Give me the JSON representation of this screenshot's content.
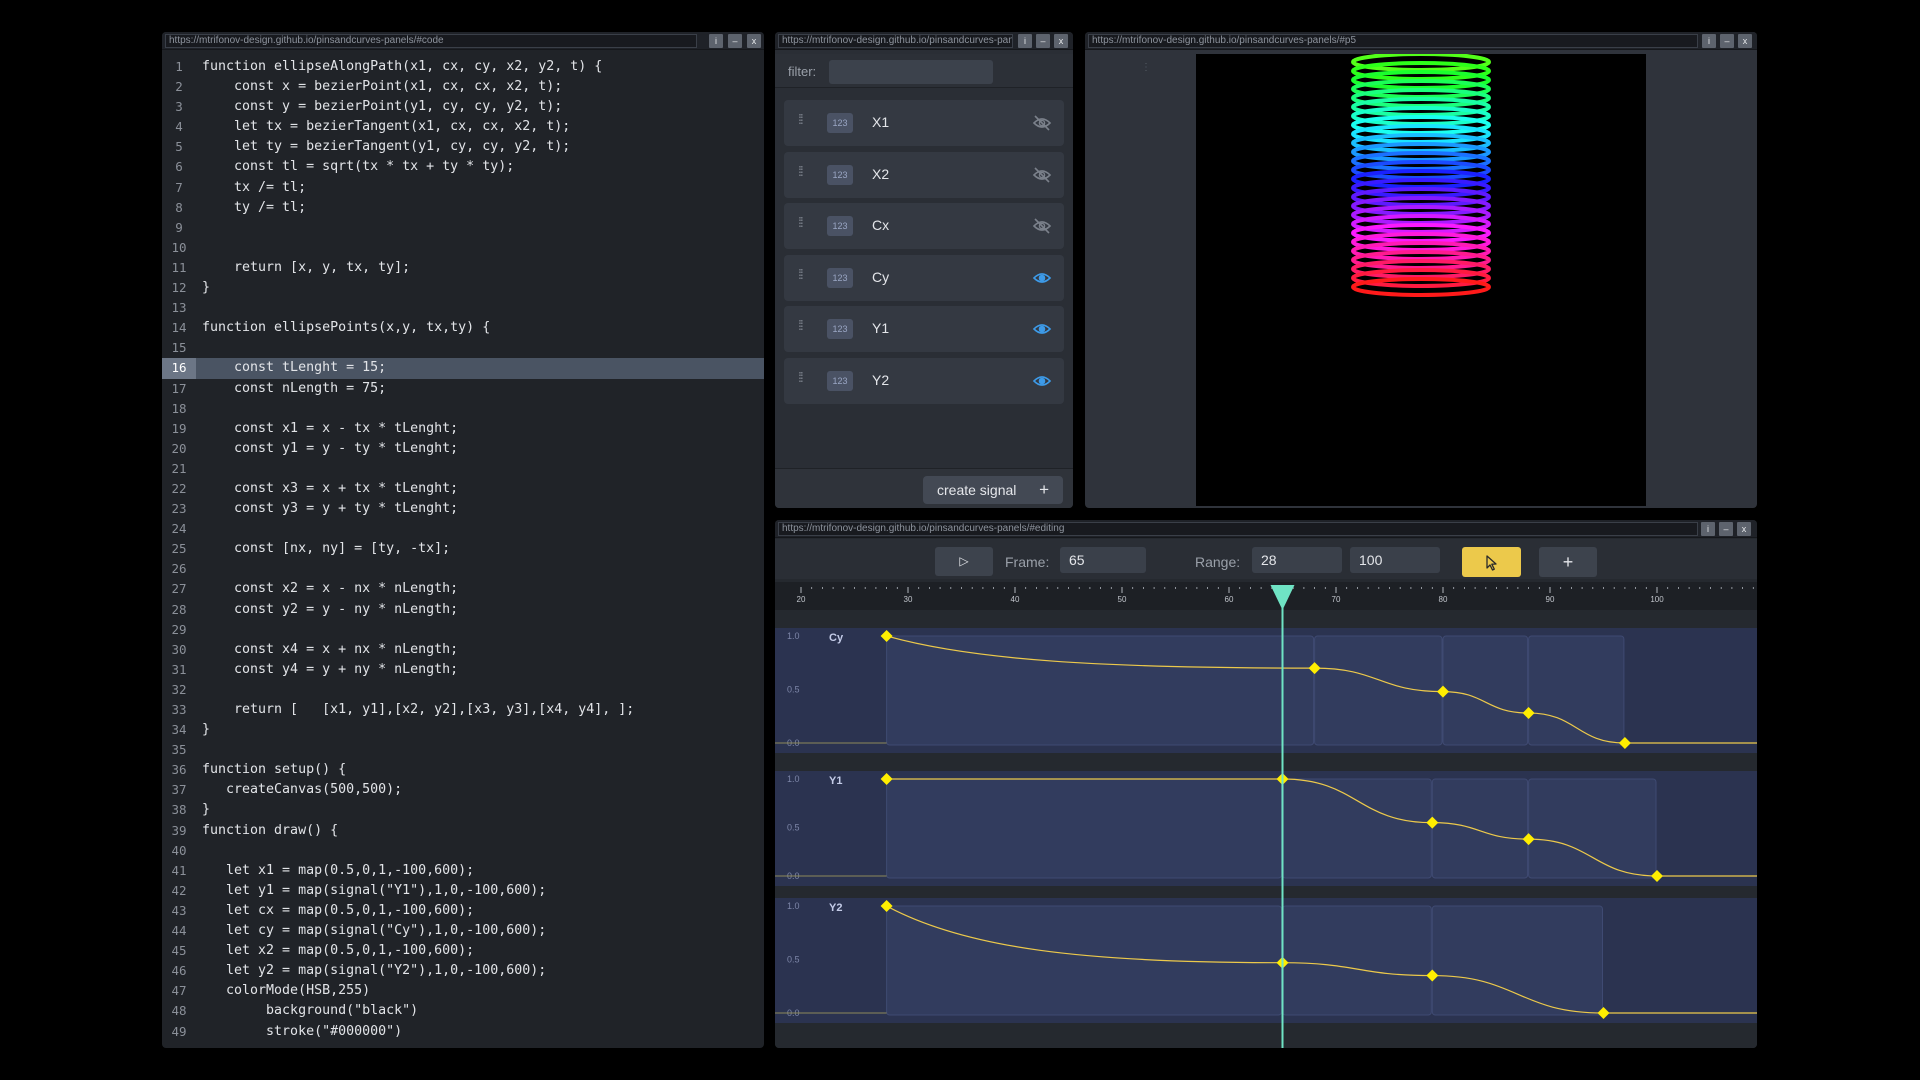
{
  "code_window": {
    "url": "https://mtrifonov-design.github.io/pinsandcurves-panels/#code",
    "buttons": [
      "i",
      "–",
      "x"
    ],
    "active_line": 16,
    "lines": [
      "function ellipseAlongPath(x1, cx, cy, x2, y2, t) {",
      "    const x = bezierPoint(x1, cx, cx, x2, t);",
      "    const y = bezierPoint(y1, cy, cy, y2, t);",
      "    let tx = bezierTangent(x1, cx, cx, x2, t);",
      "    let ty = bezierTangent(y1, cy, cy, y2, t);",
      "    const tl = sqrt(tx * tx + ty * ty);",
      "    tx /= tl;",
      "    ty /= tl;",
      "",
      "",
      "    return [x, y, tx, ty];",
      "}",
      "",
      "function ellipsePoints(x,y, tx,ty) {",
      "",
      "    const tLenght = 15;",
      "    const nLength = 75;",
      "",
      "    const x1 = x - tx * tLenght;",
      "    const y1 = y - ty * tLenght;",
      "",
      "    const x3 = x + tx * tLenght;",
      "    const y3 = y + ty * tLenght;",
      "",
      "    const [nx, ny] = [ty, -tx];",
      "",
      "    const x2 = x - nx * nLength;",
      "    const y2 = y - ny * nLength;",
      "",
      "    const x4 = x + nx * nLength;",
      "    const y4 = y + ny * nLength;",
      "",
      "    return [   [x1, y1],[x2, y2],[x3, y3],[x4, y4], ];",
      "}",
      "",
      "function setup() {",
      "   createCanvas(500,500);",
      "}",
      "function draw() {",
      "",
      "   let x1 = map(0.5,0,1,-100,600);",
      "   let y1 = map(signal(\"Y1\"),1,0,-100,600);",
      "   let cx = map(0.5,0,1,-100,600);",
      "   let cy = map(signal(\"Cy\"),1,0,-100,600);",
      "   let x2 = map(0.5,0,1,-100,600);",
      "   let y2 = map(signal(\"Y2\"),1,0,-100,600);",
      "   colorMode(HSB,255)",
      "        background(\"black\")",
      "        stroke(\"#000000\")"
    ]
  },
  "signals_window": {
    "url": "https://mtrifonov-design.github.io/pinsandcurves-panels/#signals",
    "buttons": [
      "i",
      "–",
      "x"
    ],
    "filter_label": "filter:",
    "filter_value": "",
    "type_badge": "123",
    "items": [
      {
        "name": "X1",
        "visible": false
      },
      {
        "name": "X2",
        "visible": false
      },
      {
        "name": "Cx",
        "visible": false
      },
      {
        "name": "Cy",
        "visible": true
      },
      {
        "name": "Y1",
        "visible": true
      },
      {
        "name": "Y2",
        "visible": true
      }
    ],
    "create_label": "create signal",
    "create_icon": "+"
  },
  "p5_window": {
    "url": "https://mtrifonov-design.github.io/pinsandcurves-panels/#p5",
    "buttons": [
      "i",
      "–",
      "x"
    ],
    "grip": "⋮"
  },
  "timeline_window": {
    "url": "https://mtrifonov-design.github.io/pinsandcurves-panels/#editing",
    "buttons": [
      "i",
      "–",
      "x"
    ],
    "play_icon": "▷",
    "frame_label": "Frame:",
    "frame_value": "65",
    "range_label": "Range:",
    "range_start": "28",
    "range_end": "100",
    "add_icon": "+",
    "ruler_labels": [
      20,
      30,
      40,
      50,
      60,
      70,
      80,
      90,
      100
    ],
    "playhead_frame": 65,
    "accent_color": "#ecc94b",
    "playhead_color": "#6fe3c4",
    "y_ticks": [
      "1.0",
      "0.5",
      "0.0"
    ],
    "tracks": [
      {
        "name": "Cy",
        "pins": [
          [
            28,
            1.0
          ],
          [
            68,
            0.7
          ],
          [
            80,
            0.48
          ],
          [
            88,
            0.28
          ],
          [
            97,
            0.0
          ]
        ]
      },
      {
        "name": "Y1",
        "pins": [
          [
            28,
            1.0
          ],
          [
            65,
            1.0
          ],
          [
            79,
            0.55
          ],
          [
            88,
            0.38
          ],
          [
            100,
            0.0
          ]
        ]
      },
      {
        "name": "Y2",
        "pins": [
          [
            28,
            1.0
          ],
          [
            65,
            0.47
          ],
          [
            79,
            0.35
          ],
          [
            95,
            0.0
          ]
        ]
      }
    ]
  }
}
